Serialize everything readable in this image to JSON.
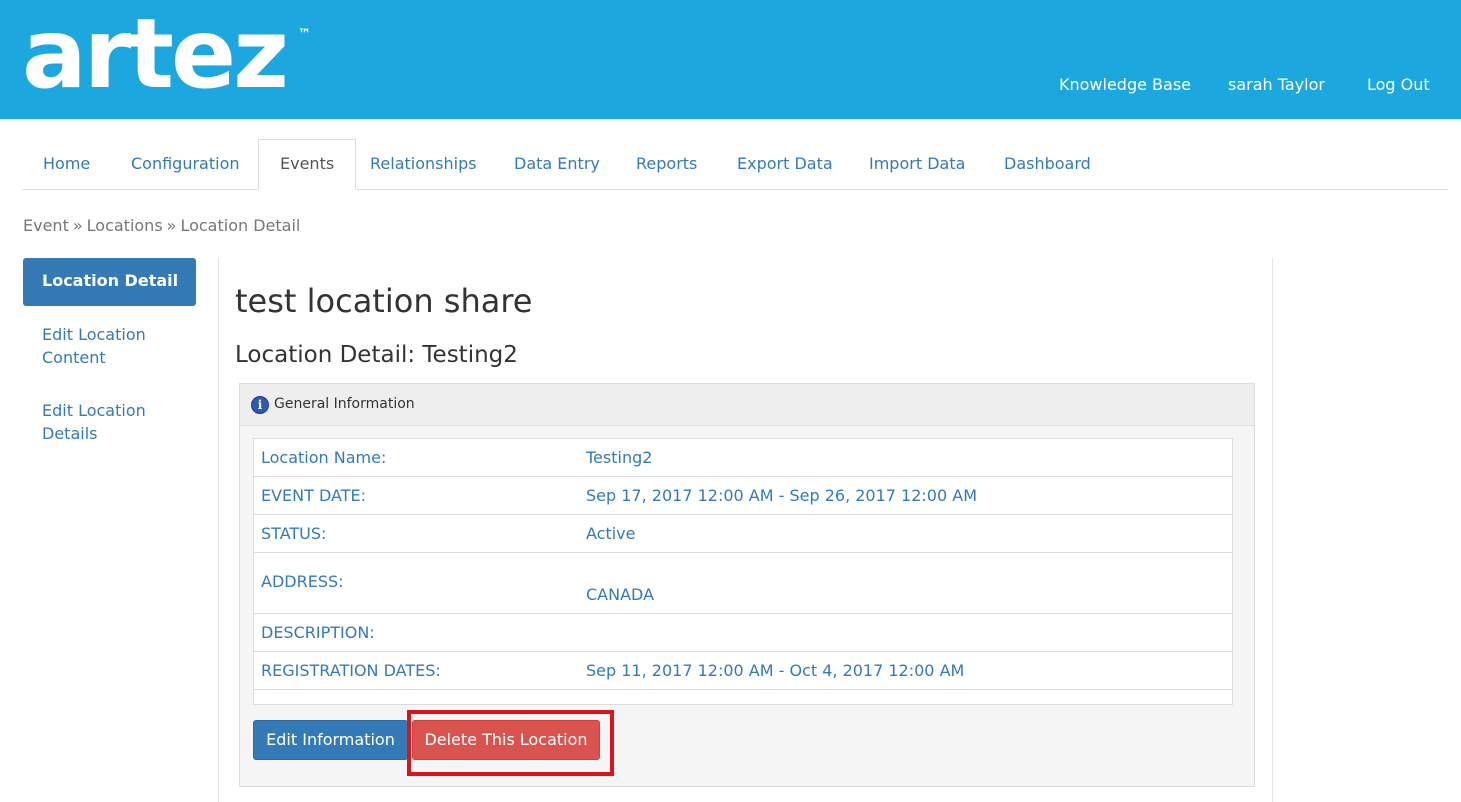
{
  "header": {
    "logo_text": "artez",
    "logo_tm": "™",
    "links": [
      "Knowledge Base",
      "sarah Taylor",
      "Log Out"
    ],
    "bg_color": "#1da7df"
  },
  "nav": {
    "tabs": [
      "Home",
      "Configuration",
      "Events",
      "Relationships",
      "Data Entry",
      "Reports",
      "Export Data",
      "Import Data",
      "Dashboard"
    ],
    "active": "Events"
  },
  "breadcrumb": {
    "items": [
      "Event",
      "Locations",
      "Location Detail"
    ],
    "separator": "»"
  },
  "sidebar": {
    "items": [
      {
        "label": "Location Detail",
        "active": true
      },
      {
        "label": "Edit Location Content",
        "active": false
      },
      {
        "label": "Edit Location Details",
        "active": false
      }
    ]
  },
  "main": {
    "title": "test location share",
    "subtitle": "Location Detail: Testing2",
    "panel_heading": "General Information",
    "info_icon": "info-icon",
    "rows": [
      {
        "label": "Location Name:",
        "value": "Testing2"
      },
      {
        "label": "EVENT DATE:",
        "value": "Sep 17, 2017 12:00 AM - Sep 26, 2017 12:00 AM"
      },
      {
        "label": "STATUS:",
        "value": "Active"
      },
      {
        "label": "ADDRESS:",
        "value": "CANADA"
      },
      {
        "label": "DESCRIPTION:",
        "value": ""
      },
      {
        "label": "REGISTRATION DATES:",
        "value": "Sep 11, 2017 12:00 AM - Oct 4, 2017 12:00 AM"
      }
    ],
    "buttons": {
      "edit": "Edit Information",
      "delete": "Delete This Location"
    }
  },
  "colors": {
    "primary": "#337ab7",
    "danger": "#d9534f",
    "highlight": "#d8141c"
  }
}
